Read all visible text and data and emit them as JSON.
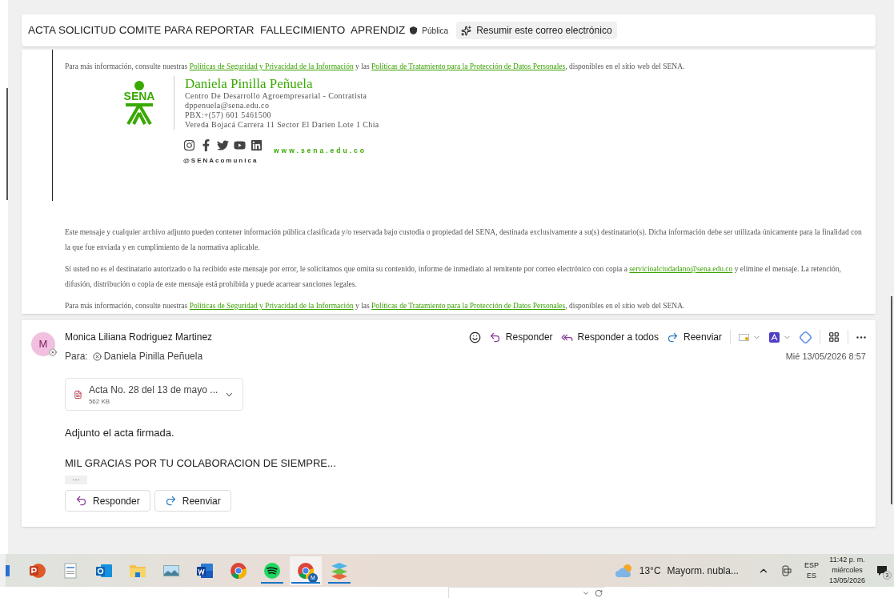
{
  "subject": {
    "title": "ACTA SOLICITUD COMITE PARA REPORTAR  FALLECIMIENTO  APRENDIZ",
    "sensitivity": "Pública",
    "summarize_button": "Resumir este correo electrónico"
  },
  "quoted_message": {
    "info_top": [
      {
        "kind": "text",
        "text": "Para más información, consulte nuestras "
      },
      {
        "kind": "link",
        "text": "Políticas de Seguridad y Privacidad de la Información"
      },
      {
        "kind": "text",
        "text": " y las "
      },
      {
        "kind": "link",
        "text": "Políticas de Tratamiento para la Protección de Datos Personales"
      },
      {
        "kind": "text",
        "text": ", disponibles en el sitio web del SENA."
      }
    ],
    "signature": {
      "logo_text": "SENA",
      "name": "Daniela Pinilla Peñuela",
      "lines": [
        "Centro De Desarrollo Agroempresarial - Contratista",
        "dppenuela@sena.edu.co",
        "PBX:+(57) 601 5461500",
        "Vereda Bojacá Carrera 11 Sector El Darien Lote 1 Chia"
      ],
      "social": [
        {
          "kind": "instagram"
        },
        {
          "kind": "facebook"
        },
        {
          "kind": "twitter"
        },
        {
          "kind": "youtube"
        },
        {
          "kind": "linkedin"
        }
      ],
      "website": "www.sena.edu.co",
      "handle": "@SENAcomunica"
    },
    "disclaimer": [
      [
        {
          "kind": "text",
          "text": "Este mensaje y cualquier archivo adjunto pueden contener información pública clasificada y/o reservada bajo custodia o propiedad del SENA, destinada exclusivamente a su(s) destinatario(s). Dicha información debe ser utilizada únicamente para la finalidad con la que fue enviada y en cumplimiento de la normativa aplicable."
        }
      ],
      [
        {
          "kind": "text",
          "text": "Si usted no es el destinatario autorizado o ha recibido este mensaje por error, le solicitamos que omita su contenido, informe de inmediato al remitente por correo electrónico con copia a "
        },
        {
          "kind": "link",
          "text": "servicioalciudadano@sena.edu.co"
        },
        {
          "kind": "text",
          "text": " y elimine el mensaje. La retención, difusión, distribución o copia de este mensaje está prohibida y puede acarrear sanciones legales."
        }
      ],
      [
        {
          "kind": "text",
          "text": "Para más información, consulte nuestras "
        },
        {
          "kind": "link",
          "text": "Políticas de Seguridad y Privacidad de la Información"
        },
        {
          "kind": "text",
          "text": " y las "
        },
        {
          "kind": "link",
          "text": "Políticas de Tratamiento para la Protección de Datos Personales"
        },
        {
          "kind": "text",
          "text": ", disponibles en el sitio web del SENA."
        }
      ]
    ]
  },
  "message": {
    "avatar_initial": "M",
    "sender": "Monica Liliana Rodriguez Martinez",
    "to_label": "Para:",
    "recipient": "Daniela Pinilla Peñuela",
    "actions": [
      {
        "kind": "reply",
        "label": "Responder"
      },
      {
        "kind": "reply_all",
        "label": "Responder a todos"
      },
      {
        "kind": "forward",
        "label": "Reenviar"
      }
    ],
    "date": "Mié 13/05/2026 8:57",
    "attachment": {
      "name": "Acta No. 28 del 13 de mayo ...",
      "size": "562 KB"
    },
    "body": [
      "Adjunto el acta firmada.",
      "MIL GRACIAS POR TU COLABORACION DE SIEMPRE..."
    ],
    "expand": "···",
    "buttons": [
      {
        "kind": "reply",
        "label": "Responder"
      },
      {
        "kind": "forward",
        "label": "Reenviar"
      }
    ]
  },
  "taskbar": {
    "apps": [
      {
        "kind": "slides",
        "running": false,
        "selected": false
      },
      {
        "kind": "doc",
        "running": false,
        "selected": false
      },
      {
        "kind": "mail",
        "running": false,
        "selected": false
      },
      {
        "kind": "folder",
        "running": false,
        "selected": false
      },
      {
        "kind": "photo",
        "running": false,
        "selected": false
      },
      {
        "kind": "word",
        "running": false,
        "selected": false
      },
      {
        "kind": "browser",
        "running": false,
        "selected": false
      },
      {
        "kind": "music",
        "running": true,
        "selected": false
      },
      {
        "kind": "browser_profile",
        "badge": "M",
        "running": true,
        "selected": true
      },
      {
        "kind": "layers",
        "running": true,
        "selected": false
      }
    ],
    "weather_temp": "13°C",
    "weather_text": "Mayorm. nubla...",
    "lang_top": "ESP",
    "lang_bottom": "ES",
    "time": "11:42 p. m.",
    "day": "miércoles",
    "date": "13/05/2026",
    "notifications": "3"
  }
}
